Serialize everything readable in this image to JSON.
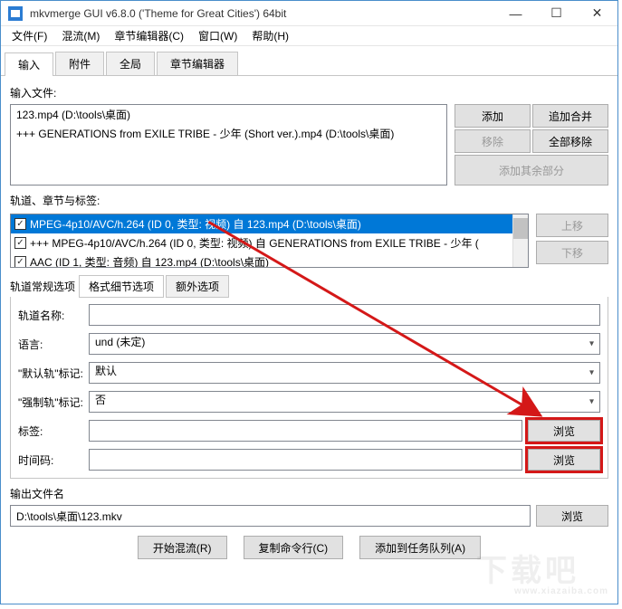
{
  "titlebar": {
    "title": "mkvmerge GUI v6.8.0 ('Theme for Great Cities') 64bit"
  },
  "menubar": {
    "file": "文件(F)",
    "mux": "混流(M)",
    "chapter": "章节编辑器(C)",
    "window": "窗口(W)",
    "help": "帮助(H)"
  },
  "tabs": {
    "input": "输入",
    "attach": "附件",
    "global": "全局",
    "chapter": "章节编辑器"
  },
  "labels": {
    "input_files": "输入文件:",
    "tracks": "轨道、章节与标签:",
    "track_opts": "轨道常规选项",
    "track_name": "轨道名称:",
    "language": "语言:",
    "default_flag": "\"默认轨\"标记:",
    "forced_flag": "\"强制轨\"标记:",
    "tags": "标签:",
    "timecodes": "时间码:",
    "output_file": "输出文件名"
  },
  "inputfiles": [
    "123.mp4 (D:\\tools\\桌面)",
    "+++ GENERATIONS from EXILE TRIBE - 少年 (Short ver.).mp4 (D:\\tools\\桌面)"
  ],
  "sidebuttons": {
    "add": "添加",
    "append": "追加合并",
    "remove": "移除",
    "remove_all": "全部移除",
    "add_other": "添加其余部分"
  },
  "tracks": [
    {
      "text": "MPEG-4p10/AVC/h.264 (ID 0, 类型: 视频) 自 123.mp4 (D:\\tools\\桌面)",
      "selected": true
    },
    {
      "text": "+++ MPEG-4p10/AVC/h.264 (ID 0, 类型: 视频) 自 GENERATIONS from EXILE TRIBE - 少年 (",
      "selected": false
    },
    {
      "text": "AAC (ID 1, 类型: 音频) 自 123.mp4 (D:\\tools\\桌面)",
      "selected": false
    }
  ],
  "track_side": {
    "up": "上移",
    "down": "下移"
  },
  "subtabs": {
    "fmt": "格式细节选项",
    "extra": "额外选项"
  },
  "form": {
    "track_name": "",
    "language": "und (未定)",
    "default_flag": "默认",
    "forced_flag": "否",
    "tags": "",
    "timecodes": ""
  },
  "buttons": {
    "browse": "浏览",
    "start": "开始混流(R)",
    "copy": "复制命令行(C)",
    "queue": "添加到任务队列(A)"
  },
  "output_file": "D:\\tools\\桌面\\123.mkv",
  "watermark": {
    "main": "下载吧",
    "sub": "www.xiazaiba.com"
  }
}
